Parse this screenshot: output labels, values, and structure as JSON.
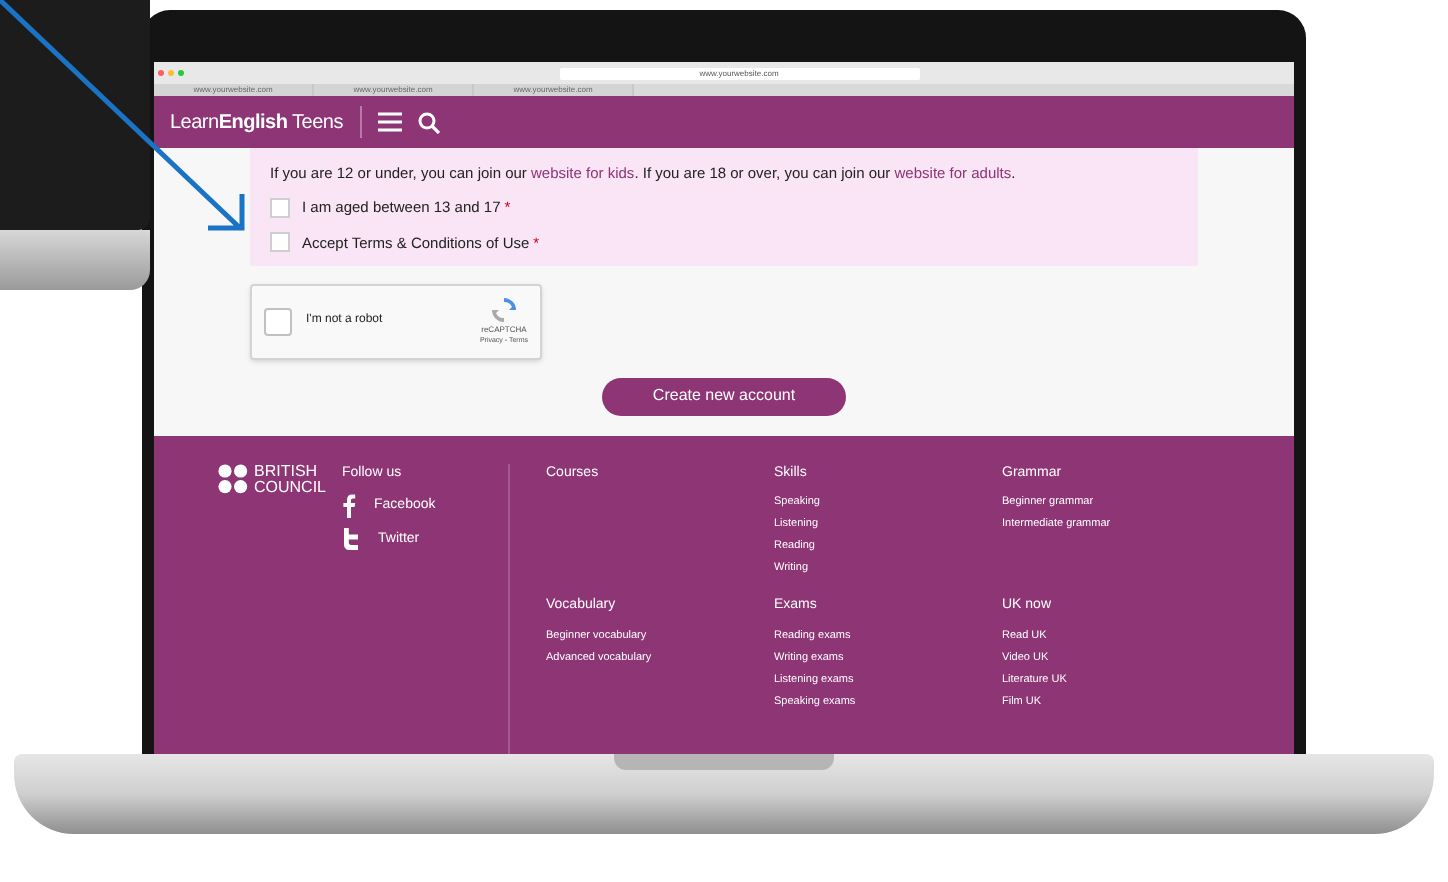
{
  "browser": {
    "address": "www.yourwebsite.com",
    "tabs": [
      {
        "title": "www.yourwebsite.com"
      },
      {
        "title": "www.yourwebsite.com"
      },
      {
        "title": "www.yourwebsite.com"
      }
    ]
  },
  "header": {
    "logo": "Learn**English** Teens"
  },
  "form": {
    "intro": [
      {
        "kind": "text",
        "text": "If you are 12 or under, you can join our "
      },
      {
        "kind": "link",
        "text": "website for kids"
      },
      {
        "kind": "text",
        "text": ". If you are 18 or over, you can join our "
      },
      {
        "kind": "link",
        "text": "website for adults"
      },
      {
        "kind": "text",
        "text": "."
      }
    ],
    "checkboxes": [
      {
        "label": "I am aged between 13 and 17",
        "required_mark": "*",
        "checked": false
      },
      {
        "label": "Accept Terms & Conditions of Use",
        "required_mark": "*",
        "checked": false
      }
    ],
    "captcha": {
      "label": "I'm not a robot",
      "checked": false,
      "brand": "reCAPTCHA",
      "links": "Privacy - Terms"
    },
    "submit": "Create new account"
  },
  "footer": {
    "logo_lines": [
      "BRITISH",
      "COUNCIL"
    ],
    "follow_title": "Follow us",
    "social": [
      {
        "kind": "facebook",
        "label": "Facebook"
      },
      {
        "kind": "twitter",
        "label": "Twitter"
      }
    ],
    "sections": [
      {
        "title": "Courses"
      },
      {
        "title": "Skills",
        "links": [
          "Speaking",
          "Listening",
          "Reading",
          "Writing"
        ]
      },
      {
        "title": "Grammar",
        "links": [
          "Beginner grammar",
          "Intermediate grammar"
        ]
      },
      {
        "title": "Vocabulary",
        "links": [
          "Beginner vocabulary",
          "Advanced vocabulary"
        ]
      },
      {
        "title": "Exams",
        "links": [
          "Reading exams",
          "Writing exams",
          "Listening exams",
          "Speaking exams"
        ]
      },
      {
        "title": "UK now",
        "links": [
          "Read UK",
          "Video UK",
          "Literature UK",
          "Film UK"
        ]
      }
    ]
  }
}
